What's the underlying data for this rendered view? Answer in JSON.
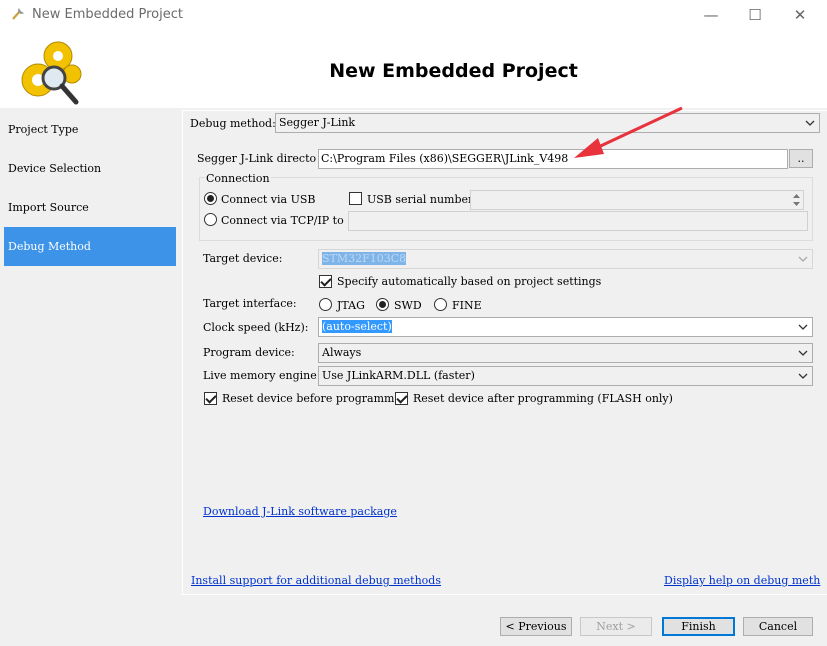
{
  "window": {
    "title": "New Embedded Project",
    "minimize": "—",
    "maximize": "☐",
    "close": "✕"
  },
  "header": {
    "heading": "New Embedded Project"
  },
  "nav": {
    "items": [
      {
        "label": "Project Type"
      },
      {
        "label": "Device Selection"
      },
      {
        "label": "Import Source"
      },
      {
        "label": "Debug Method"
      }
    ],
    "active_index": 3
  },
  "debug": {
    "method_label": "Debug method:",
    "method_value": "Segger J-Link",
    "dir_label": "Segger J-Link directo",
    "dir_value": "C:\\Program Files (x86)\\SEGGER\\JLink_V498",
    "browse_label": "..",
    "connection": {
      "group_label": "Connection",
      "usb_label": "Connect via USB",
      "usb_selected": true,
      "serial_label": "USB serial number:",
      "serial_checked": false,
      "serial_value": "",
      "tcp_label": "Connect via TCP/IP to",
      "tcp_selected": false,
      "tcp_value": ""
    },
    "target_device_label": "Target device:",
    "target_device_value": "STM32F103C8",
    "auto_label": "Specify automatically based on project settings",
    "auto_checked": true,
    "interface_label": "Target interface:",
    "interface_options": [
      {
        "label": "JTAG",
        "selected": false
      },
      {
        "label": "SWD",
        "selected": true
      },
      {
        "label": "FINE",
        "selected": false
      }
    ],
    "clock_label": "Clock speed (kHz):",
    "clock_value": "(auto-select)",
    "program_label": "Program device:",
    "program_value": "Always",
    "live_label": "Live memory engine:",
    "live_value": "Use JLinkARM.DLL (faster)",
    "reset_before_label": "Reset device before programmi",
    "reset_before_checked": true,
    "reset_after_label": "Reset device after programming (FLASH only)",
    "reset_after_checked": true,
    "download_link": "Download J-Link software package"
  },
  "footer_links": {
    "install": "Install support for additional debug methods",
    "help": "Display help on debug meth"
  },
  "buttons": {
    "previous": "< Previous",
    "next": "Next >",
    "finish": "Finish",
    "cancel": "Cancel"
  },
  "colors": {
    "accent": "#3c93e8",
    "arrow": "#e8323c",
    "link": "#0033cc"
  }
}
